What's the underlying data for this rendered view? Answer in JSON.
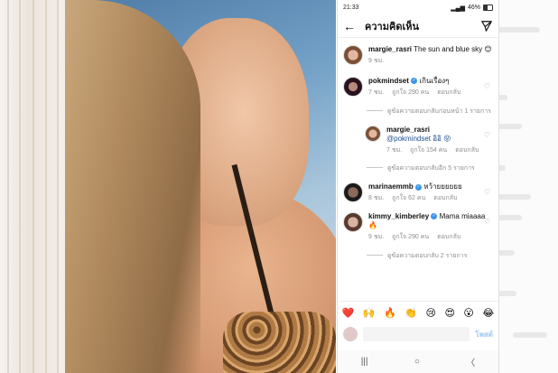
{
  "status": {
    "time": "21:33",
    "battery": "46%"
  },
  "header": {
    "title": "ความคิดเห็น"
  },
  "caption": {
    "username": "margie_rasri",
    "text": "The sun and blue sky 😊",
    "time": "9 ชม."
  },
  "comments": [
    {
      "username": "pokmindset",
      "verified": true,
      "text": "เกินเรื่องๆ",
      "time": "7 ชม.",
      "likes": "ถูกใจ 290 คน",
      "reply": "ตอบกลับ",
      "thread": "ดูข้อความตอบกลับก่อนหน้า 1 รายการ"
    },
    {
      "username": "margie_rasri",
      "verified": false,
      "text": "@pokmindset อิอิ 😝",
      "time": "7 ชม.",
      "likes": "ถูกใจ 154 คน",
      "reply": "ตอบกลับ",
      "thread": "ดูข้อความตอบกลับอีก 5 รายการ"
    },
    {
      "username": "marinaemmb",
      "verified": true,
      "text": "หว้ายยยยยย",
      "time": "8 ชม.",
      "likes": "ถูกใจ 62 คน",
      "reply": "ตอบกลับ"
    },
    {
      "username": "kimmy_kimberley",
      "verified": true,
      "text": "Mama miaaaa🔥",
      "time": "9 ชม.",
      "likes": "ถูกใจ 290 คน",
      "reply": "ตอบกลับ",
      "thread": "ดูข้อความตอบกลับ 2 รายการ"
    }
  ],
  "emojis": [
    "❤️",
    "🙌",
    "🔥",
    "👏",
    "😢",
    "😍",
    "😮",
    "😂"
  ],
  "input": {
    "post": "โพสต์"
  },
  "nav": {
    "recents": "|||",
    "home": "○",
    "back": "〈"
  },
  "colors": {
    "link": "#3897f0",
    "meta": "#8e8e8e",
    "verified": "#3897f0"
  }
}
